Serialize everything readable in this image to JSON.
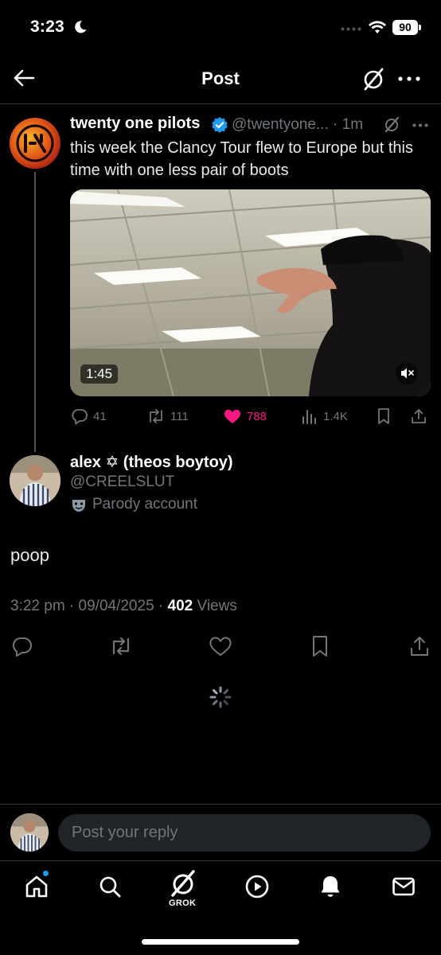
{
  "status_bar": {
    "time": "3:23",
    "battery": "90"
  },
  "header": {
    "title": "Post"
  },
  "original_post": {
    "author_name": "twenty one pilots",
    "handle_time": "@twentyone... · 1m",
    "text": "this week the Clancy Tour flew to Europe but this time with one less pair of boots",
    "video_duration": "1:45",
    "replies": "41",
    "reposts": "111",
    "likes": "788",
    "views": "1.4K"
  },
  "reply_post": {
    "author_name": "alex ✡ (theos boytoy)",
    "handle": "@CREELSLUT",
    "parody_label": "Parody account",
    "text": "poop",
    "timestamp": "3:22 pm · 09/04/2025 · ",
    "views_count": "402",
    "views_label": " Views"
  },
  "reply_bar": {
    "placeholder": "Post your reply"
  },
  "bottom_nav": {
    "grok_label": "GROK"
  },
  "colors": {
    "background": "#000000",
    "secondary_text": "#71767b",
    "like_pink": "#f91880",
    "verified_blue": "#1d9bf0",
    "divider": "#2f3336"
  },
  "icons": [
    "moon-icon",
    "wifi-icon",
    "back-arrow-icon",
    "grok-icon",
    "more-icon",
    "verified-badge-icon",
    "mute-icon",
    "reply-icon",
    "repost-icon",
    "heart-icon",
    "views-icon",
    "bookmark-icon",
    "share-icon",
    "parody-mask-icon",
    "loading-spinner-icon",
    "home-icon",
    "search-icon",
    "play-icon",
    "bell-icon",
    "mail-icon"
  ]
}
